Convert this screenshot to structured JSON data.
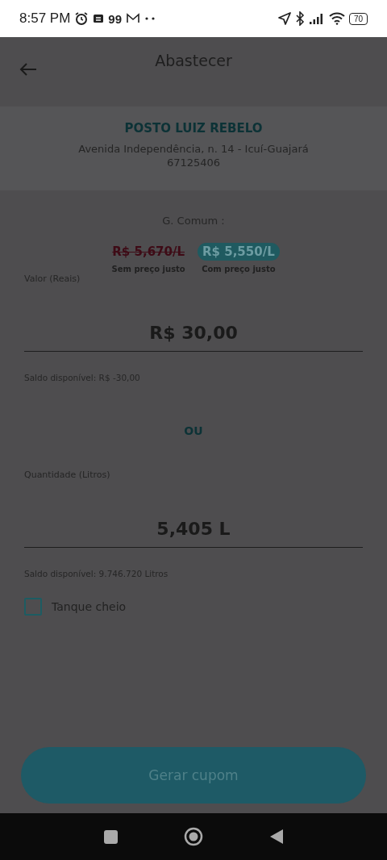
{
  "status_bar": {
    "time": "8:57 PM",
    "notification_count": "99",
    "battery": "70"
  },
  "header": {
    "title": "Abastecer"
  },
  "station": {
    "name": "POSTO LUIZ REBELO",
    "address": "Avenida Independência, n. 14 - Icuí-Guajará",
    "postal_code": "67125406"
  },
  "fuel": {
    "label": "G. Comum :",
    "prices": [
      {
        "value": "R$ 5,670/L",
        "caption": "Sem preço justo",
        "selected": false
      },
      {
        "value": "R$ 5,550/L",
        "caption": "Com preço justo",
        "selected": true
      }
    ]
  },
  "fields": [
    {
      "label": "Valor (Reais)",
      "value": "R$ 30,00",
      "balance": "Saldo disponível: R$ -30,00"
    },
    {
      "label": "Quantidade (Litros)",
      "value": "5,405 L",
      "balance": "Saldo disponível: 9.746.720 Litros"
    }
  ],
  "separator": "OU",
  "full_tank": {
    "label": "Tanque cheio",
    "checked": false
  },
  "submit": {
    "label": "Gerar cupom",
    "disabled": true
  }
}
